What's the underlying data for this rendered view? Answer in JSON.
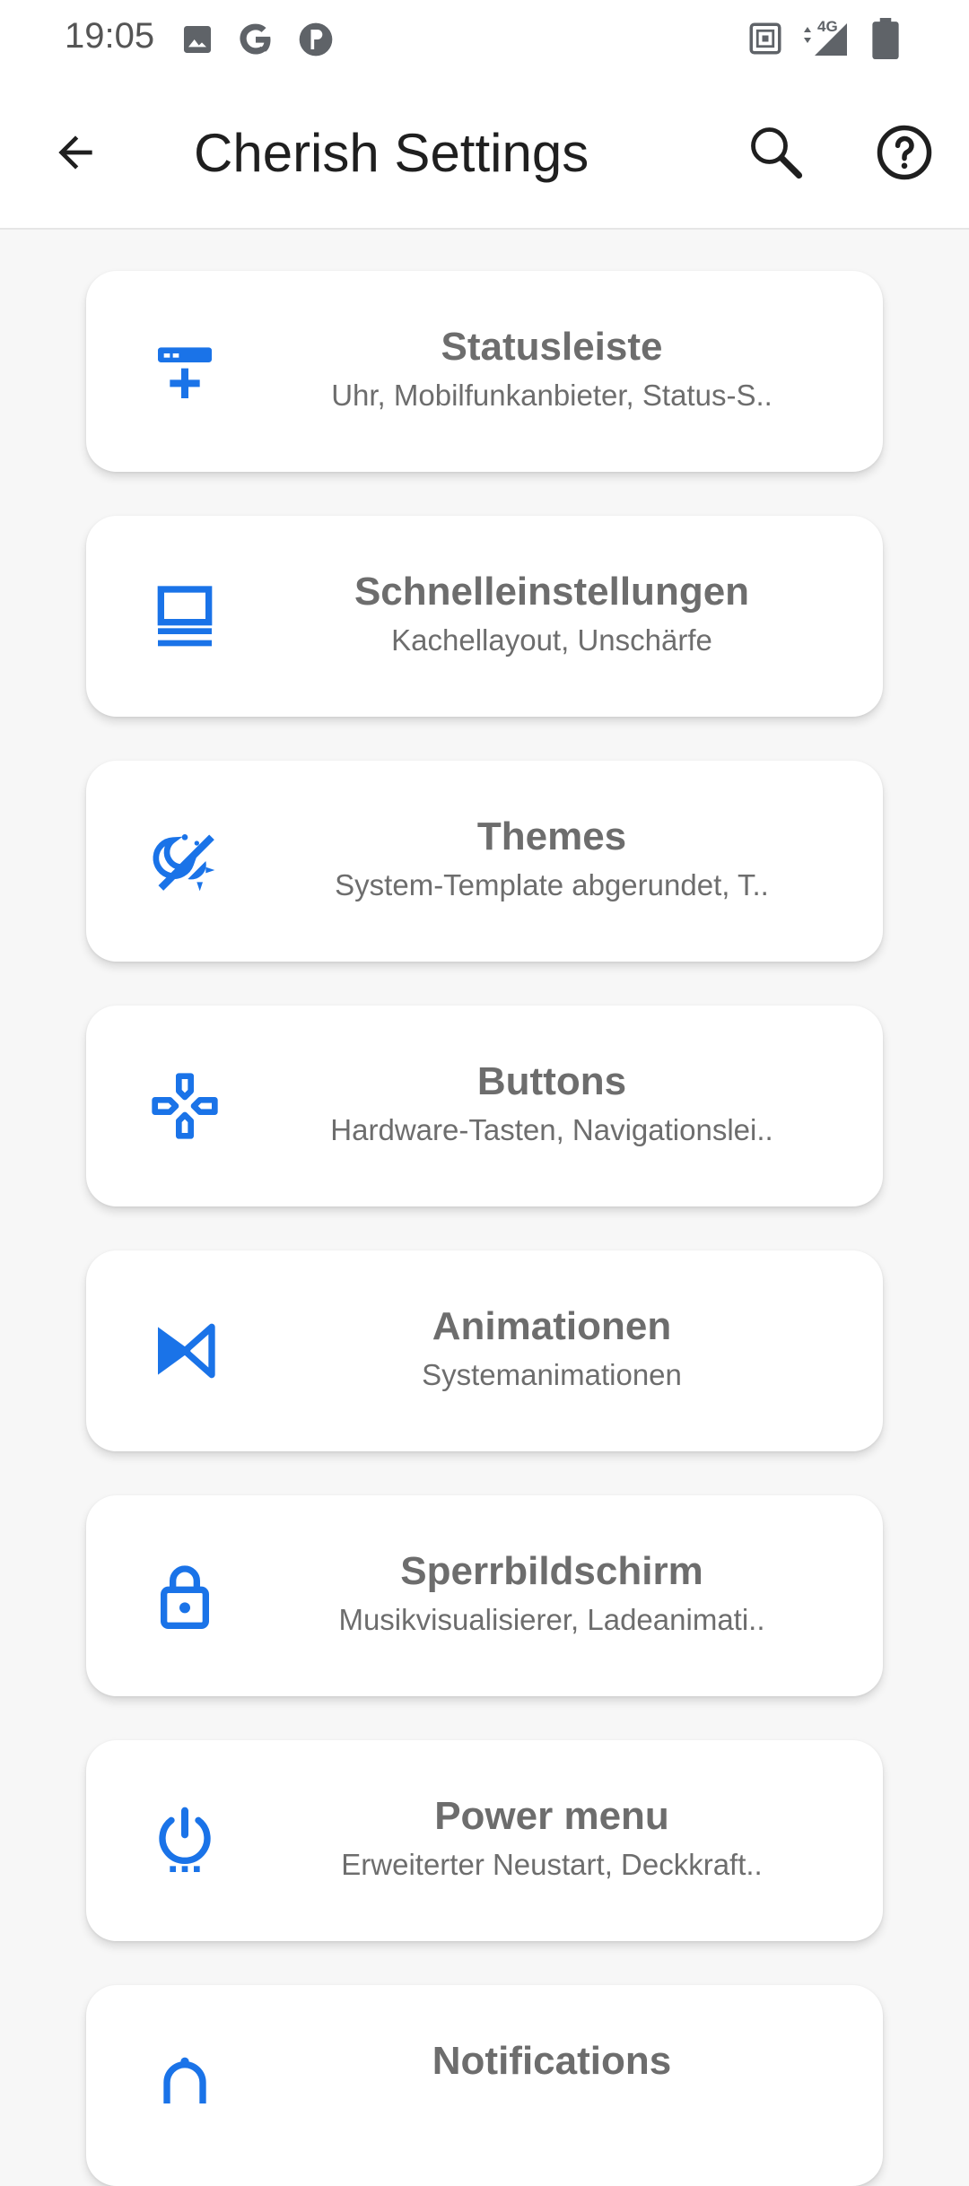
{
  "status_bar": {
    "time": "19:05",
    "network": "4G"
  },
  "app_bar": {
    "title": "Cherish Settings"
  },
  "items": [
    {
      "title": "Statusleiste",
      "subtitle": "Uhr, Mobilfunkanbieter, Status-S..",
      "icon": "statusbar-icon"
    },
    {
      "title": "Schnelleinstellungen",
      "subtitle": "Kachellayout, Unschärfe",
      "icon": "quick-settings-icon"
    },
    {
      "title": "Themes",
      "subtitle": "System-Template abgerundet, T..",
      "icon": "theme-icon"
    },
    {
      "title": "Buttons",
      "subtitle": "Hardware-Tasten, Navigationslei..",
      "icon": "gamepad-icon"
    },
    {
      "title": "Animationen",
      "subtitle": "Systemanimationen",
      "icon": "animation-icon"
    },
    {
      "title": "Sperrbildschirm",
      "subtitle": "Musikvisualisierer, Ladeanimati..",
      "icon": "lock-icon"
    },
    {
      "title": "Power menu",
      "subtitle": "Erweiterter Neustart, Deckkraft..",
      "icon": "power-icon"
    },
    {
      "title": "Notifications",
      "subtitle": "",
      "icon": "notification-icon"
    }
  ],
  "colors": {
    "accent": "#1a73e8",
    "card_text": "#6d6d6d"
  }
}
